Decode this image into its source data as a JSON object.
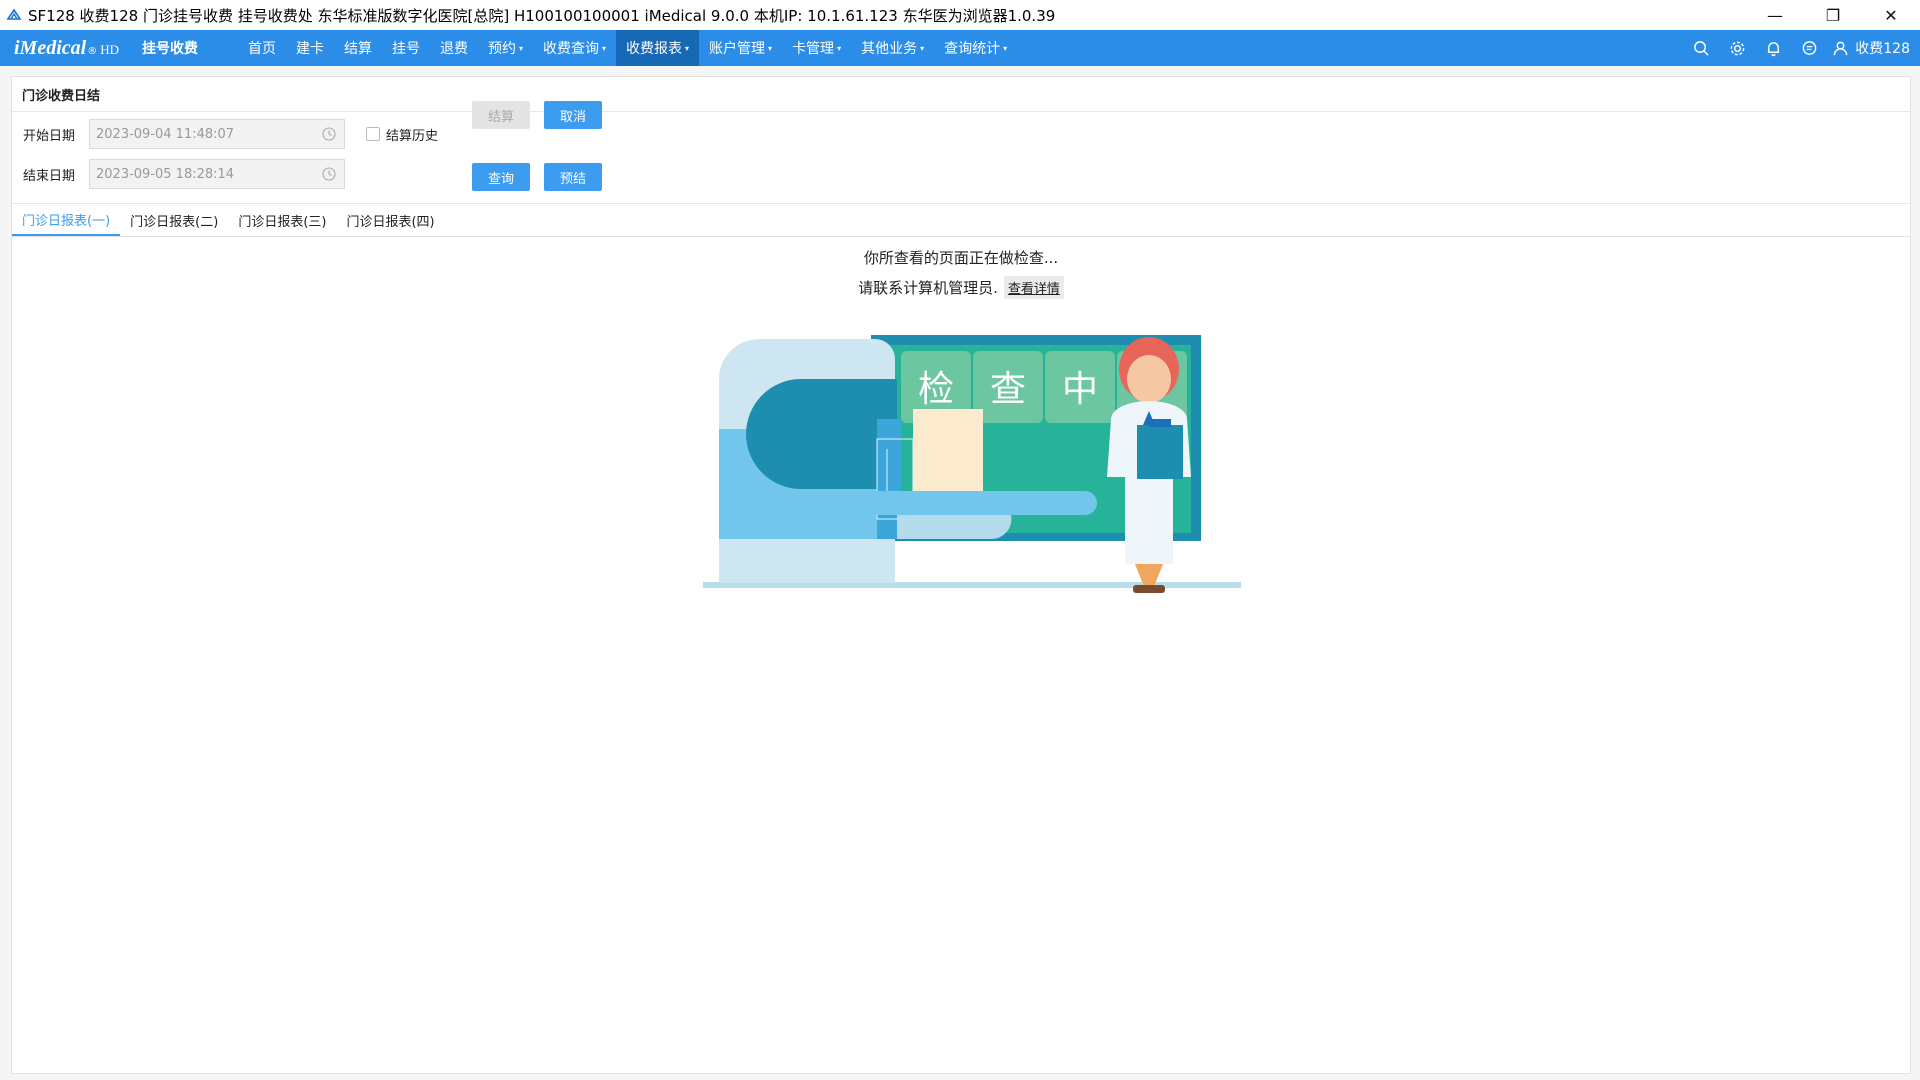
{
  "window": {
    "title": "SF128 收费128 门诊挂号收费 挂号收费处 东华标准版数字化医院[总院] H100100100001 iMedical 9.0.0 本机IP: 10.1.61.123  东华医为浏览器1.0.39",
    "minimize": "—",
    "restore": "❐",
    "close": "✕"
  },
  "nav": {
    "brand": "iMedical",
    "brand_sup": "®",
    "brand_hd": "HD",
    "module": "挂号收费",
    "menu": [
      {
        "label": "首页",
        "caret": ""
      },
      {
        "label": "建卡",
        "caret": ""
      },
      {
        "label": "结算",
        "caret": ""
      },
      {
        "label": "挂号",
        "caret": ""
      },
      {
        "label": "退费",
        "caret": ""
      },
      {
        "label": "预约",
        "caret": "▾"
      },
      {
        "label": "收费查询",
        "caret": "▾"
      },
      {
        "label": "收费报表",
        "caret": "▾"
      },
      {
        "label": "账户管理",
        "caret": "▾"
      },
      {
        "label": "卡管理",
        "caret": "▾"
      },
      {
        "label": "其他业务",
        "caret": "▾"
      },
      {
        "label": "查询统计",
        "caret": "▾"
      }
    ],
    "user": "收费128",
    "accent": "#2b8de8",
    "active_bg": "#1768b5"
  },
  "panel": {
    "title": "门诊收费日结",
    "start_label": "开始日期",
    "start_value": "2023-09-04 11:48:07",
    "end_label": "结束日期",
    "end_value": "2023-09-05 18:28:14",
    "history_label": "结算历史",
    "btn_settle": "结算",
    "btn_cancel": "取消",
    "btn_query": "查询",
    "btn_preview": "预结"
  },
  "tabs": [
    "门诊日报表(一)",
    "门诊日报表(二)",
    "门诊日报表(三)",
    "门诊日报表(四)"
  ],
  "checking": {
    "line1": "你所查看的页面正在做检查...",
    "line2": "请联系计算机管理员.",
    "link": "查看详情",
    "board_chars": [
      "检",
      "查",
      "中"
    ]
  }
}
